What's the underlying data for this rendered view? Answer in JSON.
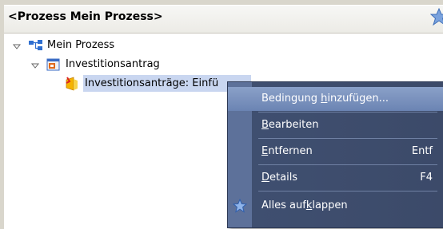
{
  "header": {
    "title": "<Prozess Mein Prozess>",
    "star_icon": "star-icon"
  },
  "tree": {
    "root": {
      "label": "Mein Prozess",
      "icon": "process-icon"
    },
    "child": {
      "label": "Investitionsantrag",
      "icon": "form-icon"
    },
    "leaf": {
      "label": "Investitionsanträge: Einfü",
      "icon": "event-icon"
    }
  },
  "menu": {
    "items": [
      {
        "pre": "Bedingung ",
        "u": "h",
        "post": "inzufügen...",
        "shortcut": ""
      },
      {
        "pre": "",
        "u": "B",
        "post": "earbeiten",
        "shortcut": ""
      },
      {
        "pre": "",
        "u": "E",
        "post": "ntfernen",
        "shortcut": "Entf"
      },
      {
        "pre": "",
        "u": "D",
        "post": "etails",
        "shortcut": "F4"
      },
      {
        "pre": "Alles auf",
        "u": "k",
        "post": "lappen",
        "shortcut": ""
      }
    ]
  },
  "colors": {
    "menu_bg": "#3f4f70",
    "highlight": "#7b93bf",
    "selection": "#c9d6f0"
  }
}
